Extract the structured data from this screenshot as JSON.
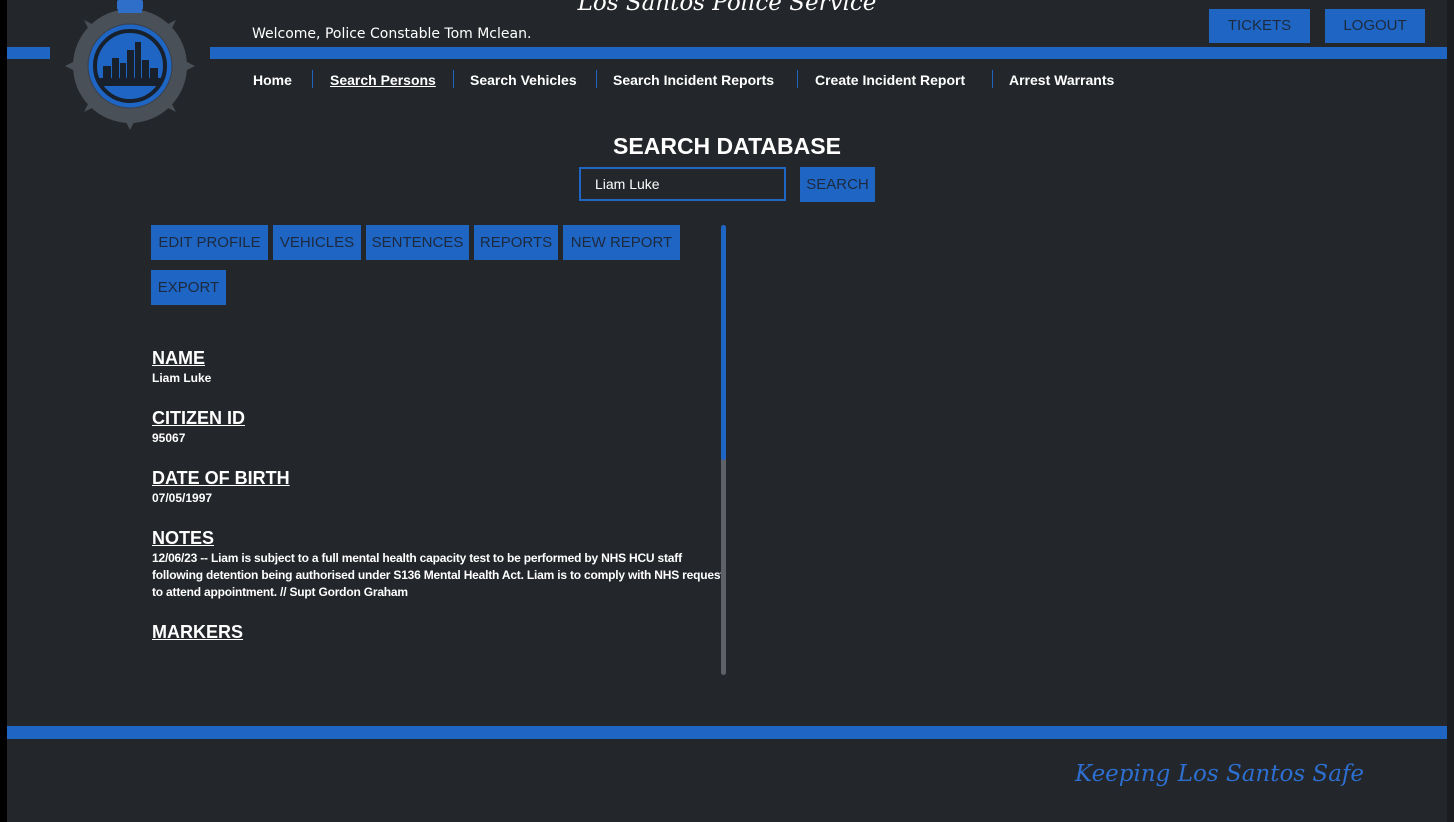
{
  "header": {
    "site_title": "Los Santos Police Service",
    "welcome_text": "Welcome, Police Constable Tom Mclean.",
    "tickets_label": "TICKETS",
    "logout_label": "LOGOUT",
    "logo_icon": "police-badge-icon"
  },
  "nav": {
    "items": [
      {
        "label": "Home",
        "active": false
      },
      {
        "label": "Search Persons",
        "active": true
      },
      {
        "label": "Search Vehicles",
        "active": false
      },
      {
        "label": "Search Incident Reports",
        "active": false
      },
      {
        "label": "Create Incident Report",
        "active": false
      },
      {
        "label": "Arrest Warrants",
        "active": false
      }
    ]
  },
  "search": {
    "title": "SEARCH DATABASE",
    "value": "Liam Luke",
    "button_label": "SEARCH"
  },
  "profile": {
    "actions": {
      "edit_profile": "EDIT PROFILE",
      "vehicles": "VEHICLES",
      "sentences": "SENTENCES",
      "reports": "REPORTS",
      "new_report": "NEW REPORT",
      "export": "EXPORT"
    },
    "fields": {
      "name_label": "NAME",
      "name_value": "Liam Luke",
      "citizen_id_label": "CITIZEN ID",
      "citizen_id_value": "95067",
      "dob_label": "DATE OF BIRTH",
      "dob_value": "07/05/1997",
      "notes_label": "NOTES",
      "notes_value": " 12/06/23 -- Liam is subject to a full mental health capacity test to be performed by NHS HCU staff following detention being authorised under S136 Mental Health Act. Liam is to comply with NHS request to attend appointment. // Supt Gordon Graham",
      "markers_label": "MARKERS"
    }
  },
  "footer": {
    "slogan": "Keeping Los Santos Safe"
  },
  "colors": {
    "background": "#23262a",
    "accent": "#1f65c4",
    "text": "#ffffff",
    "button_text": "#1d2a3d"
  }
}
